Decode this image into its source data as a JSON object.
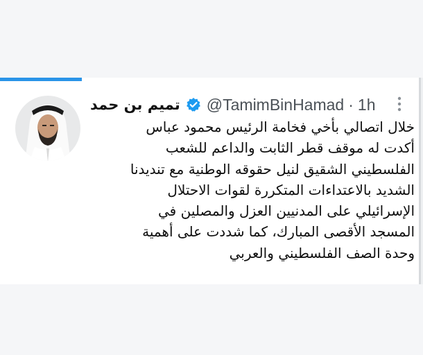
{
  "tweet": {
    "display_name": "تميم بن حمد",
    "handle": "@TamimBinHamad",
    "separator": "·",
    "time": "1h",
    "verified": true,
    "lines": [
      "خلال اتصالي بأخي فخامة الرئيس محمود عباس",
      "أكدت له موقف قطر الثابت والداعم للشعب",
      "الفلسطيني الشقيق لنيل حقوقه الوطنية مع تنديدنا",
      "الشديد بالاعتداءات المتكررة لقوات الاحتلال",
      "الإسرائيلي على المدنيين العزل والمصلين في",
      "المسجد الأقصى المبارك، كما شددت على أهمية",
      "وحدة الصف الفلسطيني والعربي"
    ]
  },
  "icons": {
    "verified": "verified-badge-icon",
    "more": "more-vertical-icon"
  },
  "colors": {
    "accent": "#2a94e8",
    "verified": "#1d9bf0",
    "text": "#0f0f0f",
    "secondary_text": "#4b5157"
  }
}
